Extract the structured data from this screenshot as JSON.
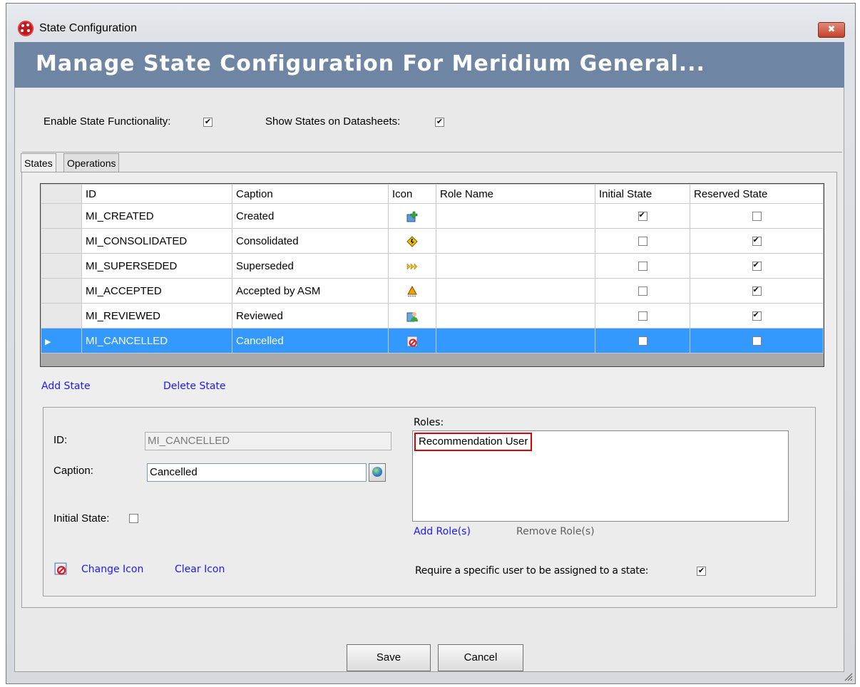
{
  "window": {
    "title": "State Configuration",
    "close_glyph": "✖"
  },
  "banner": {
    "text": "Manage State Configuration For Meridium General..."
  },
  "options": {
    "enable_state_label": "Enable State Functionality:",
    "enable_state_checked": true,
    "show_states_label": "Show States on Datasheets:",
    "show_states_checked": true
  },
  "tabs": [
    {
      "label": "States",
      "active": true
    },
    {
      "label": "Operations",
      "active": false
    }
  ],
  "grid": {
    "columns": [
      "ID",
      "Caption",
      "Icon",
      "Role Name",
      "Initial State",
      "Reserved State"
    ],
    "rows": [
      {
        "id": "MI_CREATED",
        "caption": "Created",
        "icon": "created-icon",
        "role_name": "",
        "initial": true,
        "reserved": false,
        "selected": false
      },
      {
        "id": "MI_CONSOLIDATED",
        "caption": "Consolidated",
        "icon": "consolidated-icon",
        "role_name": "",
        "initial": false,
        "reserved": true,
        "selected": false
      },
      {
        "id": "MI_SUPERSEDED",
        "caption": "Superseded",
        "icon": "superseded-icon",
        "role_name": "",
        "initial": false,
        "reserved": true,
        "selected": false
      },
      {
        "id": "MI_ACCEPTED",
        "caption": "Accepted by ASM",
        "icon": "accepted-icon",
        "role_name": "",
        "initial": false,
        "reserved": true,
        "selected": false
      },
      {
        "id": "MI_REVIEWED",
        "caption": "Reviewed",
        "icon": "reviewed-icon",
        "role_name": "",
        "initial": false,
        "reserved": true,
        "selected": false
      },
      {
        "id": "MI_CANCELLED",
        "caption": "Cancelled",
        "icon": "cancelled-icon",
        "role_name": "",
        "initial": false,
        "reserved": false,
        "selected": true
      }
    ]
  },
  "links": {
    "add_state": "Add State",
    "delete_state": "Delete State"
  },
  "details": {
    "id_label": "ID:",
    "id_value": "MI_CANCELLED",
    "caption_label": "Caption:",
    "caption_value": "Cancelled",
    "initial_state_label": "Initial State:",
    "initial_state_checked": false,
    "change_icon": "Change Icon",
    "clear_icon": "Clear Icon",
    "roles_label": "Roles:",
    "roles": [
      "Recommendation User"
    ],
    "add_roles": "Add Role(s)",
    "remove_roles": "Remove Role(s)",
    "require_user_label": "Require a specific user to be assigned to a state:",
    "require_user_checked": true
  },
  "buttons": {
    "save": "Save",
    "cancel": "Cancel"
  },
  "colors": {
    "banner": "#6e86a3",
    "selection": "#3399ff",
    "link": "#1a1aff",
    "role_highlight": "#e00000"
  }
}
